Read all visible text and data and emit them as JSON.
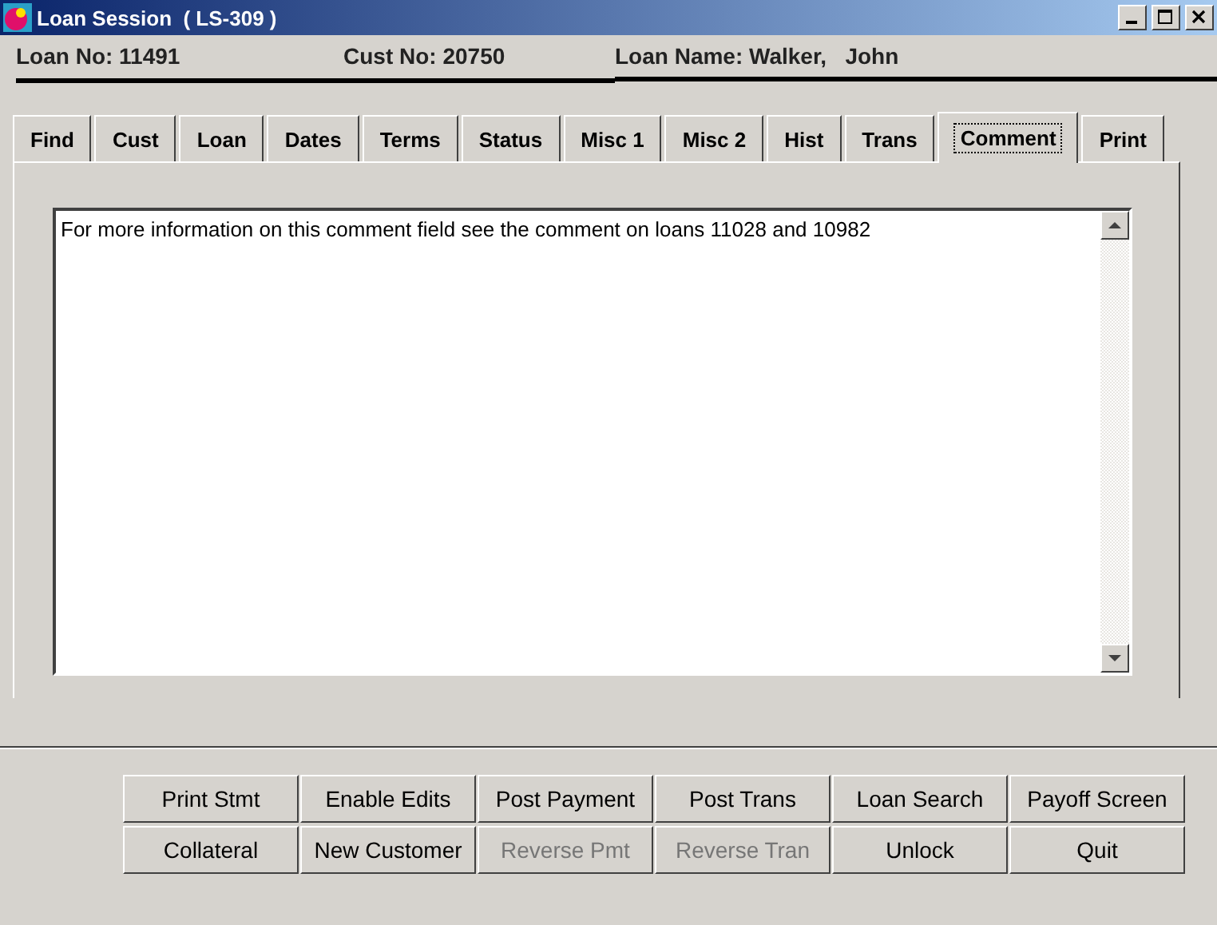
{
  "window": {
    "title": "Loan Session  ( LS-309 )"
  },
  "header": [
    {
      "label": "Loan No:",
      "value": "11491"
    },
    {
      "label": "Cust No:",
      "value": "20750"
    },
    {
      "label": "Loan Name:",
      "value": "Walker,   John"
    }
  ],
  "tabs": [
    {
      "label": "Find",
      "selected": false
    },
    {
      "label": "Cust",
      "selected": false
    },
    {
      "label": "Loan",
      "selected": false
    },
    {
      "label": "Dates",
      "selected": false
    },
    {
      "label": "Terms",
      "selected": false
    },
    {
      "label": "Status",
      "selected": false
    },
    {
      "label": "Misc 1",
      "selected": false
    },
    {
      "label": "Misc 2",
      "selected": false
    },
    {
      "label": "Hist",
      "selected": false
    },
    {
      "label": "Trans",
      "selected": false
    },
    {
      "label": "Comment",
      "selected": true
    },
    {
      "label": "Print",
      "selected": false
    }
  ],
  "comment": {
    "value": "For more information on this comment field see the comment on loans 11028 and 10982"
  },
  "buttons": [
    {
      "label": "Print Stmt",
      "disabled": false
    },
    {
      "label": "Enable Edits",
      "disabled": false
    },
    {
      "label": "Post Payment",
      "disabled": false
    },
    {
      "label": "Post Trans",
      "disabled": false
    },
    {
      "label": "Loan Search",
      "disabled": false
    },
    {
      "label": "Payoff Screen",
      "disabled": false
    },
    {
      "label": "Collateral",
      "disabled": false
    },
    {
      "label": "New Customer",
      "disabled": false
    },
    {
      "label": "Reverse Pmt",
      "disabled": true
    },
    {
      "label": "Reverse Tran",
      "disabled": true
    },
    {
      "label": "Unlock",
      "disabled": false
    },
    {
      "label": "Quit",
      "disabled": false
    }
  ]
}
